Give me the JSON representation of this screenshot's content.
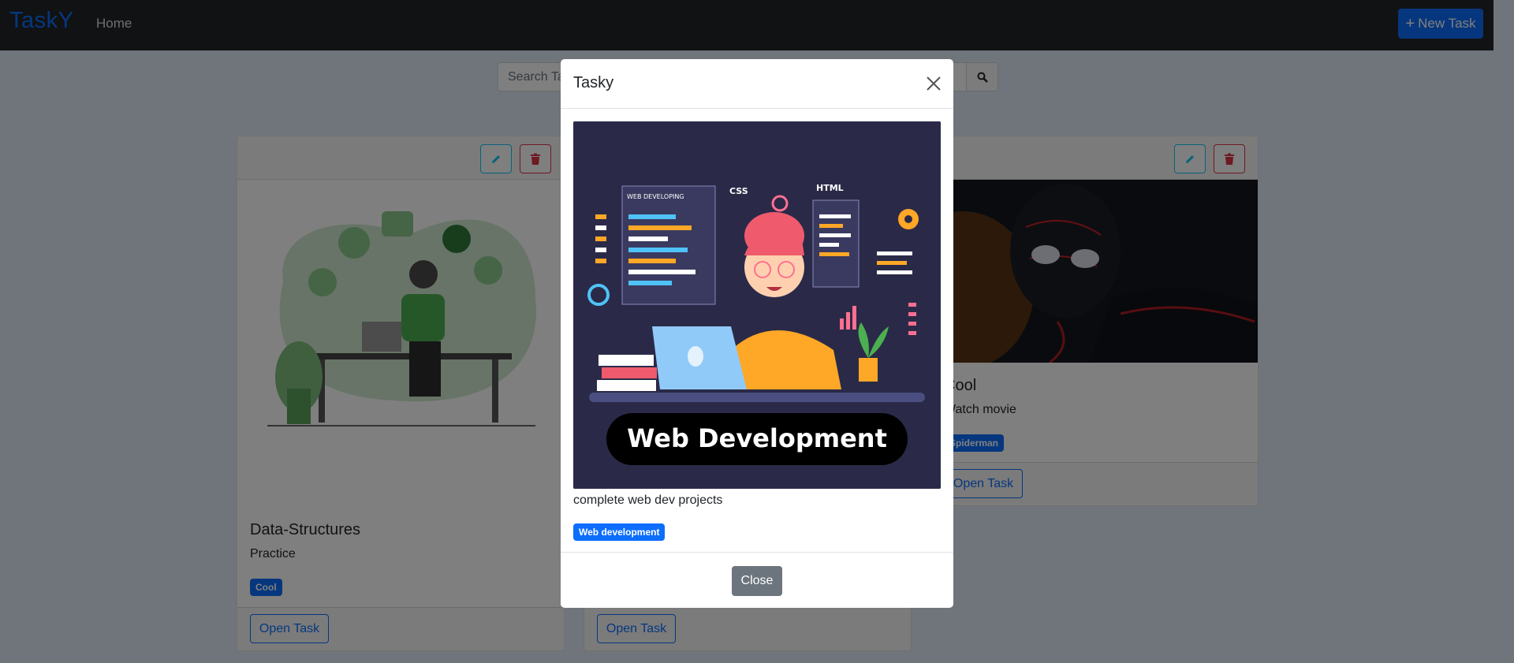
{
  "navbar": {
    "brand": "TaskY",
    "home_label": "Home",
    "new_task_label": "New Task",
    "new_task_icon": "plus-icon"
  },
  "search": {
    "placeholder": "Search Tasks",
    "button_icon": "search-icon"
  },
  "cards": [
    {
      "title": "Data-Structures",
      "description": "Practice",
      "tag": "Cool",
      "open_label": "Open Task",
      "image": "developer-at-desk-illustration"
    },
    {
      "title": "",
      "description": "",
      "tag": "",
      "open_label": "Open Task",
      "image": ""
    },
    {
      "title": "Cool",
      "description": "Watch movie",
      "tag": "Spiderman",
      "open_label": "Open Task",
      "image": "spiderman-miles-morales-image"
    }
  ],
  "modal": {
    "title": "Tasky",
    "image_caption": "Web Development",
    "image_labels": [
      "WEB DEVELOPING",
      "CSS",
      "HTML"
    ],
    "description": "complete web dev projects",
    "tag": "Web development",
    "close_label": "Close"
  },
  "colors": {
    "primary": "#0d6efd",
    "navbar": "#212529",
    "danger": "#dc3545",
    "info": "#0dcaf0",
    "secondary": "#6c757d"
  }
}
